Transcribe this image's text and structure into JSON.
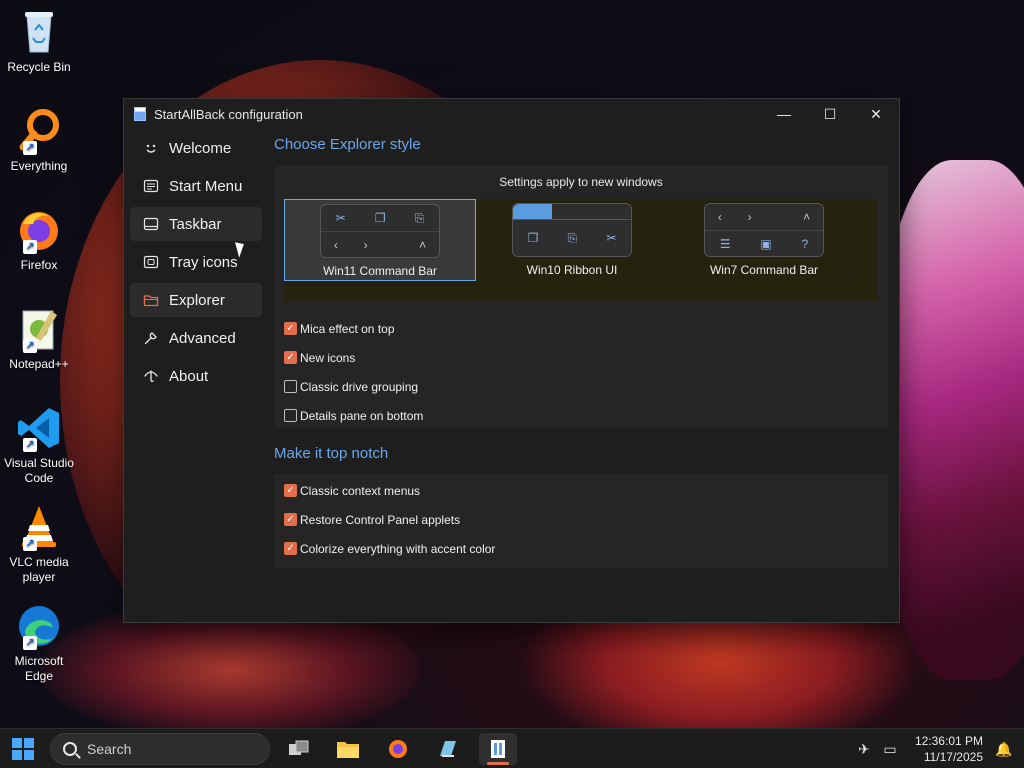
{
  "desktop": {
    "icons": [
      {
        "label": "Recycle Bin"
      },
      {
        "label": "Everything"
      },
      {
        "label": "Firefox"
      },
      {
        "label": "Notepad++"
      },
      {
        "label": "Visual Studio Code"
      },
      {
        "label": "VLC media player"
      },
      {
        "label": "Microsoft Edge"
      }
    ]
  },
  "window": {
    "title": "StartAllBack configuration",
    "controls": {
      "minimize": "—",
      "maximize": "☐",
      "close": "✕"
    }
  },
  "sidebar": {
    "items": [
      {
        "label": "Welcome",
        "icon": "smile-icon"
      },
      {
        "label": "Start Menu",
        "icon": "start-menu-icon"
      },
      {
        "label": "Taskbar",
        "icon": "taskbar-icon"
      },
      {
        "label": "Tray icons",
        "icon": "tray-icon"
      },
      {
        "label": "Explorer",
        "icon": "folder-icon"
      },
      {
        "label": "Advanced",
        "icon": "wrench-icon"
      },
      {
        "label": "About",
        "icon": "umbrella-icon"
      }
    ],
    "active": "Explorer"
  },
  "explorer": {
    "section_title": "Choose Explorer style",
    "note": "Settings apply to new windows",
    "styles": [
      {
        "label": "Win11 Command Bar",
        "selected": true
      },
      {
        "label": "Win10 Ribbon UI",
        "selected": false
      },
      {
        "label": "Win7 Command Bar",
        "selected": false
      }
    ],
    "options": [
      {
        "label": "Mica effect on top",
        "checked": true
      },
      {
        "label": "New icons",
        "checked": true
      },
      {
        "label": "Classic drive grouping",
        "checked": false
      },
      {
        "label": "Details pane on bottom",
        "checked": false
      }
    ]
  },
  "top_notch": {
    "section_title": "Make it top notch",
    "options": [
      {
        "label": "Classic context menus",
        "checked": true
      },
      {
        "label": "Restore Control Panel applets",
        "checked": true
      },
      {
        "label": "Colorize everything with accent color",
        "checked": true
      }
    ]
  },
  "taskbar": {
    "search_placeholder": "Search",
    "clock_time": "12:36:01 PM",
    "clock_date": "11/17/2025"
  },
  "colors": {
    "accent": "#6aa7ea",
    "checkbox": "#e36e4b",
    "window_bg": "#1e1e1e"
  }
}
